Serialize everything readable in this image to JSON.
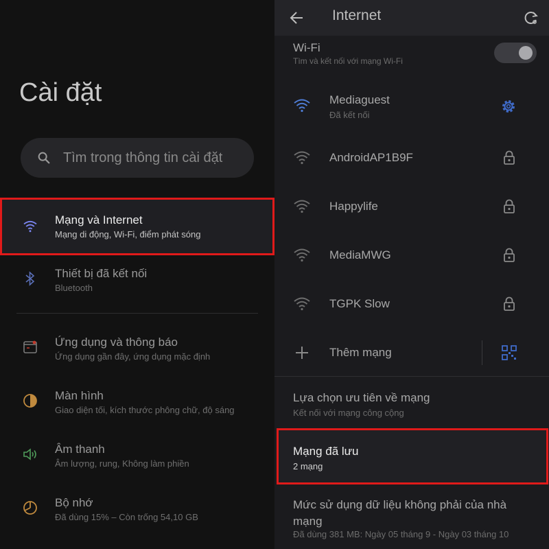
{
  "settings": {
    "title": "Cài đặt",
    "search_placeholder": "Tìm trong thông tin cài đặt",
    "items": [
      {
        "label": "Mạng và Internet",
        "sub": "Mạng di động, Wi-Fi, điểm phát sóng",
        "icon": "wifi-icon"
      },
      {
        "label": "Thiết bị đã kết nối",
        "sub": "Bluetooth",
        "icon": "bluetooth-icon"
      },
      {
        "label": "Ứng dụng và thông báo",
        "sub": "Ứng dụng gần đây, ứng dụng mặc định",
        "icon": "apps-icon"
      },
      {
        "label": "Màn hình",
        "sub": "Giao diện tối, kích thước phông chữ, độ sáng",
        "icon": "display-icon"
      },
      {
        "label": "Âm thanh",
        "sub": "Âm lượng, rung, Không làm phiền",
        "icon": "sound-icon"
      },
      {
        "label": "Bộ nhớ",
        "sub": "Đã dùng 15% – Còn trống 54,10 GB",
        "icon": "storage-icon"
      }
    ]
  },
  "internet": {
    "title": "Internet",
    "wifi_label": "Wi-Fi",
    "wifi_sub": "Tìm và kết nối với mạng Wi-Fi",
    "wifi_enabled": true,
    "networks": [
      {
        "name": "Mediaguest",
        "status": "Đã kết nối",
        "action_icon": "gear-icon"
      },
      {
        "name": "AndroidAP1B9F",
        "action_icon": "lock-icon"
      },
      {
        "name": "Happylife",
        "action_icon": "lock-icon"
      },
      {
        "name": "MediaMWG",
        "action_icon": "lock-icon"
      },
      {
        "name": "TGPK Slow",
        "action_icon": "lock-icon"
      }
    ],
    "add_network": "Thêm mạng",
    "prefs_label": "Lựa chọn ưu tiên về mạng",
    "prefs_sub": "Kết nối với mạng công cộng",
    "saved_label": "Mạng đã lưu",
    "saved_sub": "2 mạng",
    "data_usage_label": "Mức sử dụng dữ liệu không phải của nhà mạng",
    "data_usage_sub": "Đã dùng 381 MB: Ngày 05 tháng 9 - Ngày 03 tháng 10"
  },
  "colors": {
    "accent": "#7b86f2",
    "connected": "#4f7dd6",
    "highlight": "#e01a1a"
  }
}
